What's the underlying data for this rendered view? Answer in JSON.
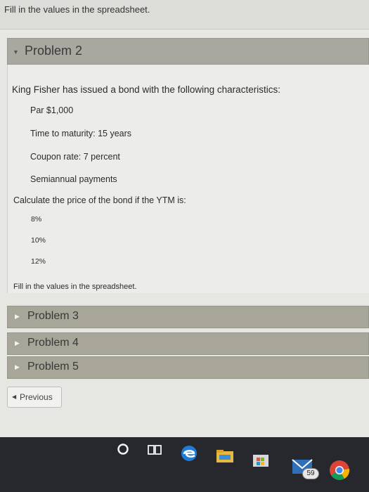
{
  "top": {
    "instruction": "Fill in the values in the spreadsheet."
  },
  "problem2": {
    "title": "Problem 2",
    "intro": "King Fisher has issued a bond with the following characteristics:",
    "par": "Par $1,000",
    "maturity": "Time to maturity: 15 years",
    "coupon": "Coupon rate: 7 percent",
    "payments": "Semiannual payments",
    "question": "Calculate the price of the bond if the YTM is:",
    "ytm": [
      "8%",
      "10%",
      "12%"
    ],
    "footer": "Fill in the values in the spreadsheet."
  },
  "problems": [
    "Problem 3",
    "Problem 4",
    "Problem 5"
  ],
  "nav": {
    "previous": "Previous"
  },
  "taskbar": {
    "mail_badge": "59"
  }
}
